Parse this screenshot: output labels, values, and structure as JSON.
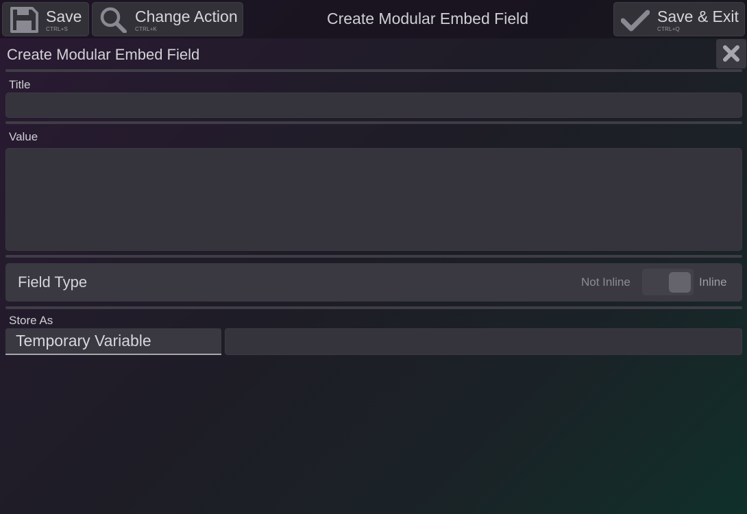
{
  "toolbar": {
    "save": {
      "label": "Save",
      "shortcut": "CTRL+S",
      "icon": "floppy-disk-icon"
    },
    "change_action": {
      "label": "Change Action",
      "shortcut": "CTRL+K",
      "icon": "magnifier-icon"
    },
    "save_exit": {
      "label": "Save & Exit",
      "shortcut": "CTRL+Q",
      "icon": "checkmark-icon"
    },
    "title": "Create Modular Embed Field"
  },
  "panel": {
    "title": "Create Modular Embed Field",
    "close_icon": "close-x-icon"
  },
  "fields": {
    "title": {
      "label": "Title",
      "value": "",
      "placeholder": ""
    },
    "value": {
      "label": "Value",
      "value": "",
      "placeholder": ""
    },
    "field_type": {
      "label": "Field Type",
      "off_label": "Not Inline",
      "on_label": "Inline",
      "inline": true
    },
    "store_as": {
      "label": "Store As",
      "selected": "Temporary Variable",
      "variable_name": "",
      "placeholder": ""
    }
  },
  "colors": {
    "accent_border": "#a9a7ae",
    "panel_bg": "#3a3841",
    "input_bg": "#35333b"
  }
}
